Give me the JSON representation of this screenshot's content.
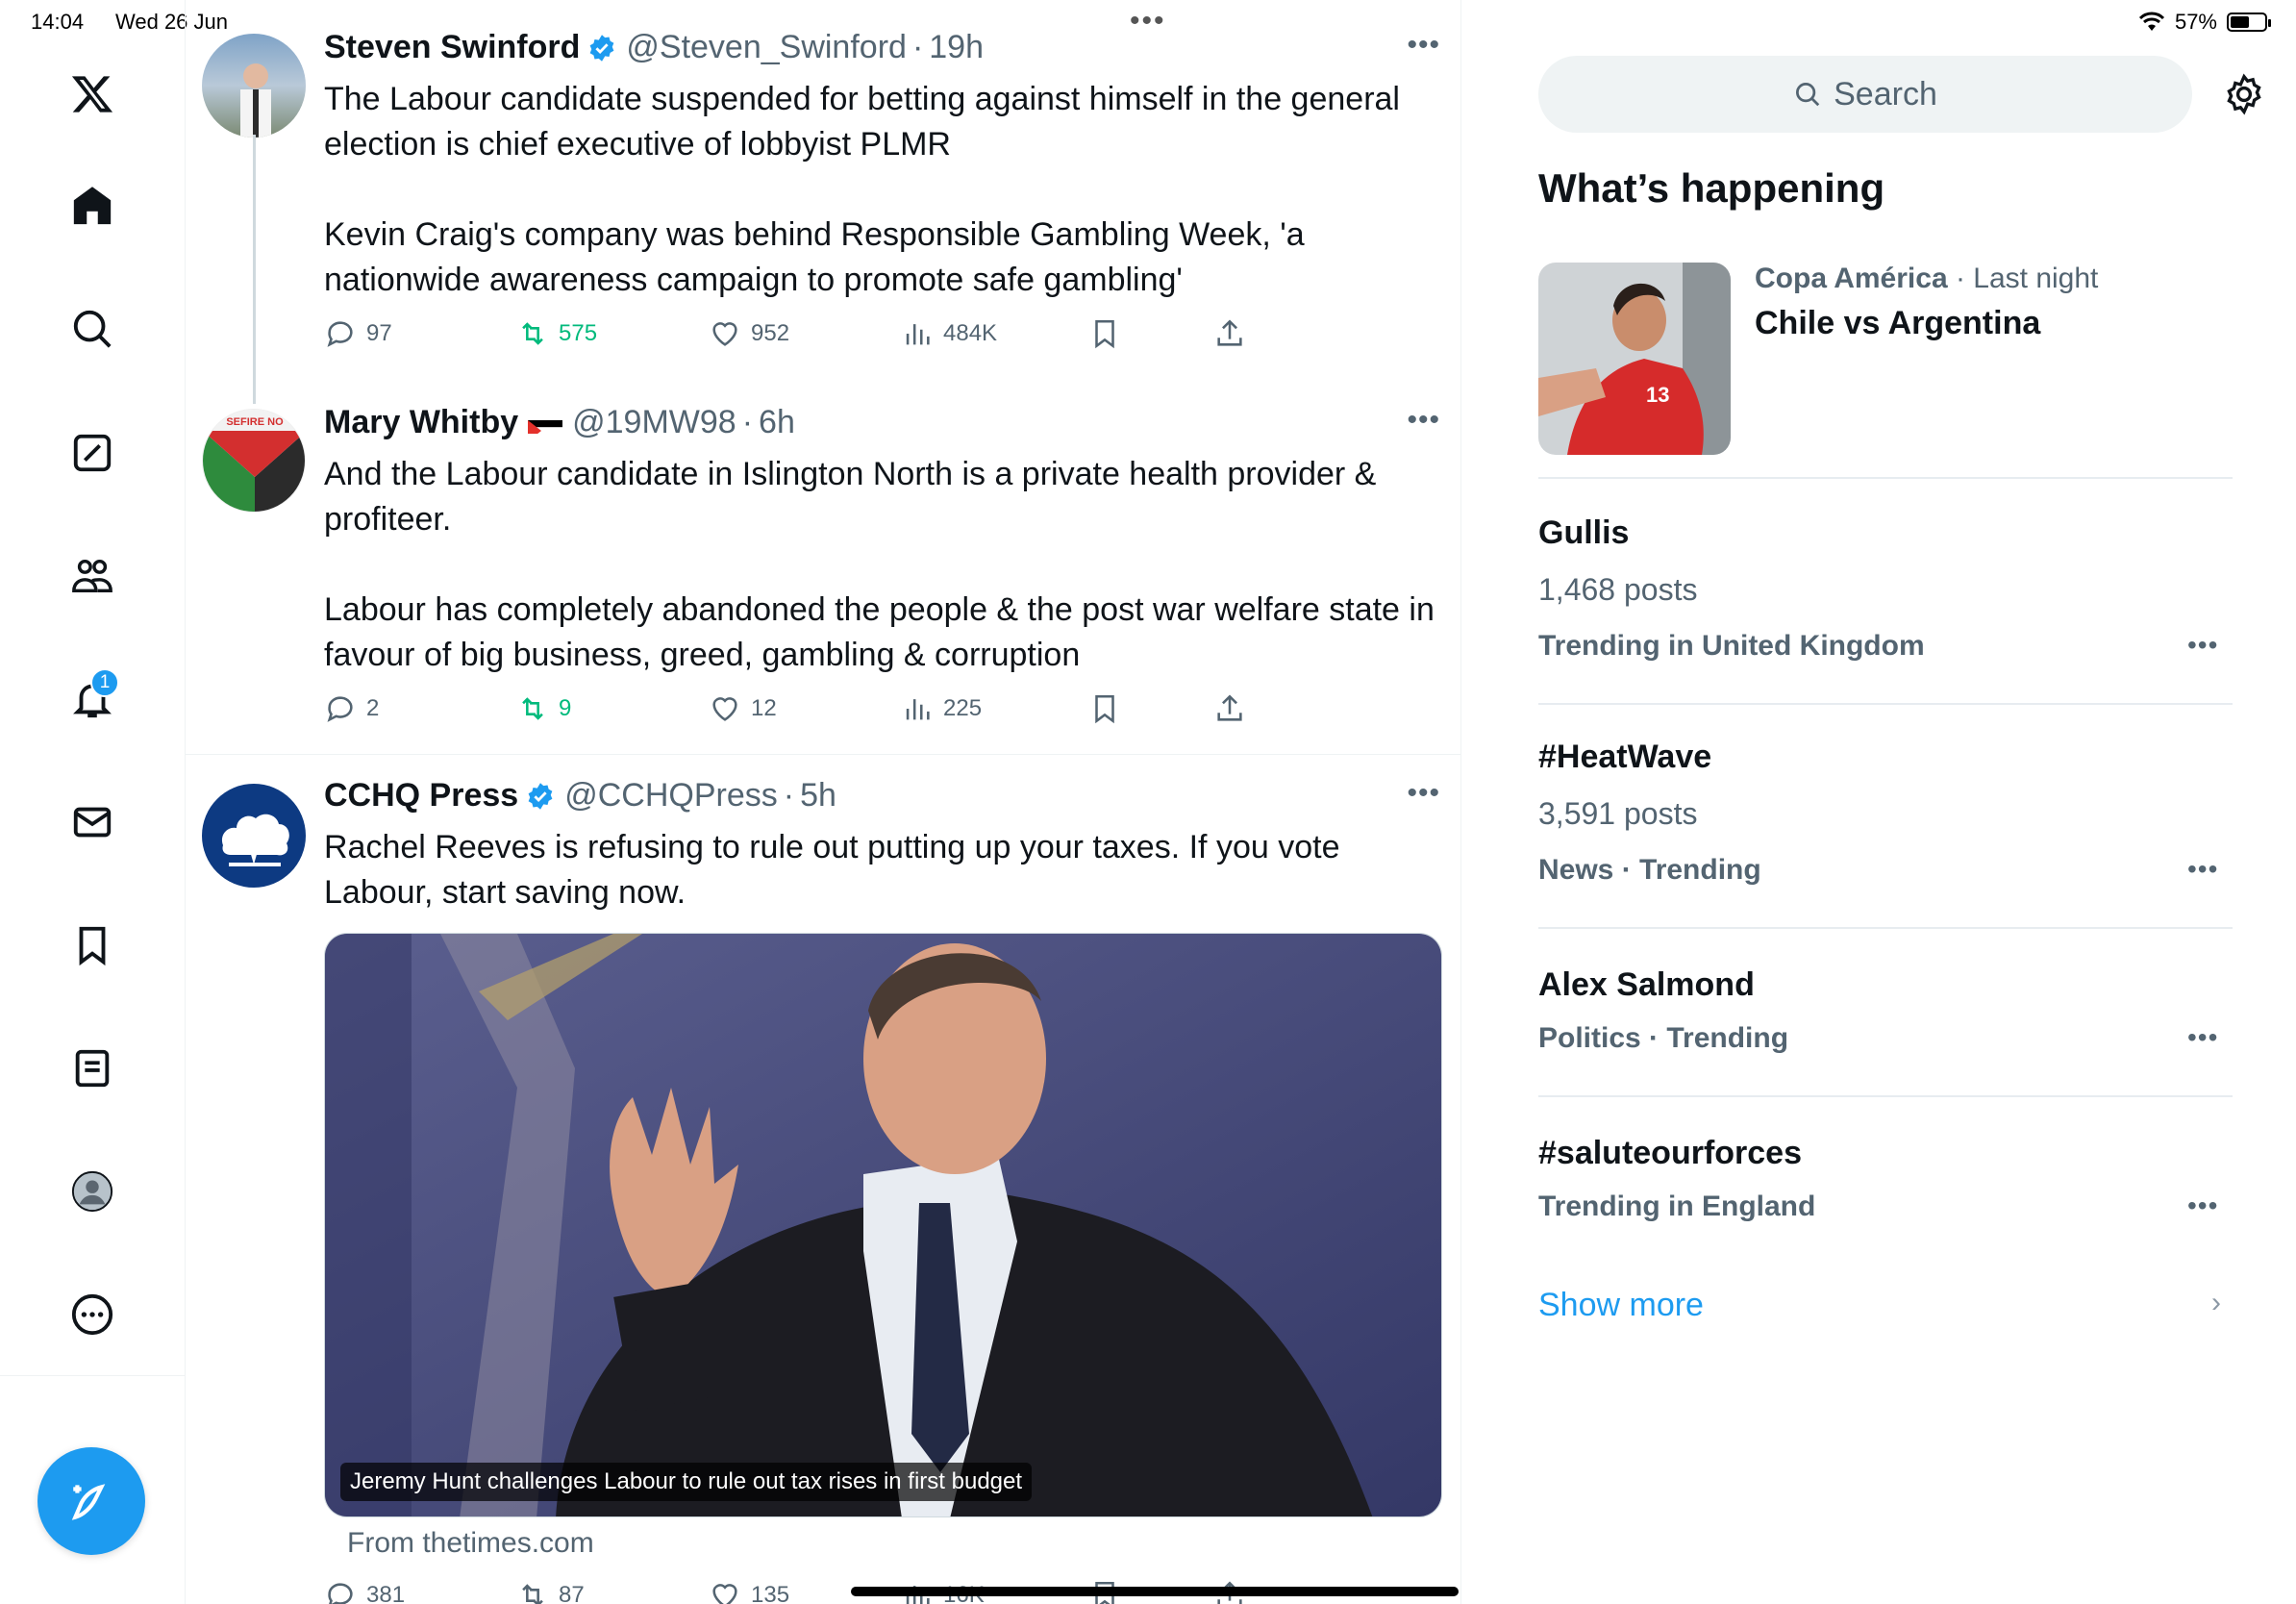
{
  "status_bar": {
    "time": "14:04",
    "date": "Wed 26 Jun",
    "battery": "57%",
    "battery_level": 0.57
  },
  "nav": {
    "notifications_badge": "1",
    "colors": {
      "accent": "#1d9bf0"
    }
  },
  "tweets": [
    {
      "name": "Steven Swinford",
      "handle": "@Steven_Swinford",
      "time": "19h",
      "verified": true,
      "text": "The Labour candidate suspended for betting against himself in the general election is chief executive of lobbyist PLMR\n\nKevin Craig's company was behind Responsible Gambling Week, 'a nationwide awareness campaign to promote safe gambling'",
      "replies": "97",
      "reposts": "575",
      "likes": "952",
      "views": "484K"
    },
    {
      "name": "Mary Whitby",
      "handle": "@19MW98",
      "time": "6h",
      "verified": false,
      "avatar_text": "SEFIRE NO",
      "text": "And the Labour candidate in Islington North is a private health provider & profiteer.\n\nLabour has completely abandoned the people & the post war welfare state in favour of big business, greed, gambling & corruption",
      "replies": "2",
      "reposts": "9",
      "likes": "12",
      "views": "225"
    },
    {
      "name": "CCHQ Press",
      "handle": "@CCHQPress",
      "time": "5h",
      "verified": true,
      "text": "Rachel Reeves is refusing to rule out putting up your taxes. If you vote Labour, start saving now.",
      "media_caption": "Jeremy Hunt challenges Labour to rule out tax rises in first budget",
      "media_from": "From thetimes.com",
      "replies": "381",
      "reposts": "87",
      "likes": "135",
      "views": "16K"
    }
  ],
  "sidebar": {
    "search_placeholder": "Search",
    "whats_happening": "What’s happening",
    "featured": {
      "category": "Copa América",
      "time": "Last night",
      "title": "Chile vs Argentina",
      "jersey_number": "13"
    },
    "trends": [
      {
        "name": "Gullis",
        "posts": "1,468 posts",
        "context": "Trending in United Kingdom"
      },
      {
        "name": "#HeatWave",
        "posts": "3,591 posts",
        "context": "News · Trending"
      },
      {
        "name": "Alex Salmond",
        "posts": "",
        "context": "Politics · Trending"
      },
      {
        "name": "#saluteourforces",
        "posts": "",
        "context": "Trending in England"
      }
    ],
    "show_more": "Show more"
  }
}
